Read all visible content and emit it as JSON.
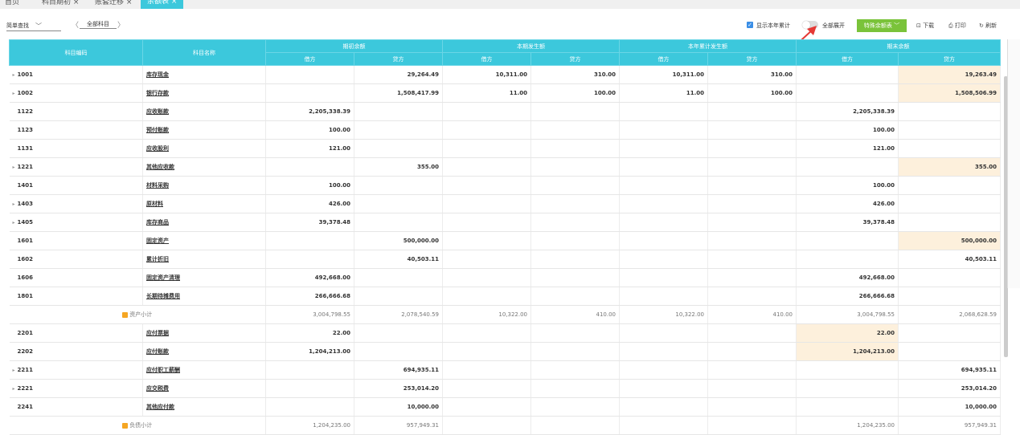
{
  "tabs": [
    "首页",
    "科目期初 ×",
    "账套迁移 ×",
    "余额表 ×"
  ],
  "toolbar": {
    "quick_find": "简单查找",
    "prev": "〈",
    "next": "〉",
    "all_subjects": "全部科目",
    "show_year_label": "显示本年累计",
    "expand_all_label": "全部展开",
    "special_label": "特殊余额表",
    "download": "下载",
    "print": "打印",
    "refresh": "刷新"
  },
  "headers": {
    "code": "科目编码",
    "name": "科目名称",
    "groups": [
      "期初余额",
      "本期发生额",
      "本年累计发生额",
      "期末余额"
    ],
    "debit": "借方",
    "credit": "贷方"
  },
  "rows": [
    {
      "code": "1001",
      "name": "库存现金",
      "expand": true,
      "v": [
        "",
        "29,264.49",
        "10,311.00",
        "310.00",
        "10,311.00",
        "310.00",
        "",
        "19,263.49"
      ],
      "hl": [
        7
      ]
    },
    {
      "code": "1002",
      "name": "银行存款",
      "expand": true,
      "v": [
        "",
        "1,508,417.99",
        "11.00",
        "100.00",
        "11.00",
        "100.00",
        "",
        "1,508,506.99"
      ],
      "hl": [
        7
      ]
    },
    {
      "code": "1122",
      "name": "应收账款",
      "v": [
        "2,205,338.39",
        "",
        "",
        "",
        "",
        "",
        "2,205,338.39",
        ""
      ]
    },
    {
      "code": "1123",
      "name": "预付账款",
      "v": [
        "100.00",
        "",
        "",
        "",
        "",
        "",
        "100.00",
        ""
      ]
    },
    {
      "code": "1131",
      "name": "应收股利",
      "v": [
        "121.00",
        "",
        "",
        "",
        "",
        "",
        "121.00",
        ""
      ]
    },
    {
      "code": "1221",
      "name": "其他应收款",
      "expand": true,
      "v": [
        "",
        "355.00",
        "",
        "",
        "",
        "",
        "",
        "355.00"
      ],
      "hl": [
        7
      ]
    },
    {
      "code": "1401",
      "name": "材料采购",
      "v": [
        "100.00",
        "",
        "",
        "",
        "",
        "",
        "100.00",
        ""
      ]
    },
    {
      "code": "1403",
      "name": "原材料",
      "expand": true,
      "v": [
        "426.00",
        "",
        "",
        "",
        "",
        "",
        "426.00",
        ""
      ]
    },
    {
      "code": "1405",
      "name": "库存商品",
      "expand": true,
      "v": [
        "39,378.48",
        "",
        "",
        "",
        "",
        "",
        "39,378.48",
        ""
      ]
    },
    {
      "code": "1601",
      "name": "固定资产",
      "v": [
        "",
        "500,000.00",
        "",
        "",
        "",
        "",
        "",
        "500,000.00"
      ],
      "hl": [
        7
      ]
    },
    {
      "code": "1602",
      "name": "累计折旧",
      "v": [
        "",
        "40,503.11",
        "",
        "",
        "",
        "",
        "",
        "40,503.11"
      ]
    },
    {
      "code": "1606",
      "name": "固定资产清理",
      "v": [
        "492,668.00",
        "",
        "",
        "",
        "",
        "",
        "492,668.00",
        ""
      ]
    },
    {
      "code": "1801",
      "name": "长期待摊费用",
      "v": [
        "266,666.68",
        "",
        "",
        "",
        "",
        "",
        "266,666.68",
        ""
      ]
    },
    {
      "subtotal": true,
      "name": "资产小计",
      "v": [
        "3,004,798.55",
        "2,078,540.59",
        "10,322.00",
        "410.00",
        "10,322.00",
        "410.00",
        "3,004,798.55",
        "2,068,628.59"
      ]
    },
    {
      "code": "2201",
      "name": "应付票据",
      "v": [
        "22.00",
        "",
        "",
        "",
        "",
        "",
        "22.00",
        ""
      ],
      "hl": [
        6
      ]
    },
    {
      "code": "2202",
      "name": "应付账款",
      "v": [
        "1,204,213.00",
        "",
        "",
        "",
        "",
        "",
        "1,204,213.00",
        ""
      ],
      "hl": [
        6
      ]
    },
    {
      "code": "2211",
      "name": "应付职工薪酬",
      "expand": true,
      "v": [
        "",
        "694,935.11",
        "",
        "",
        "",
        "",
        "",
        "694,935.11"
      ]
    },
    {
      "code": "2221",
      "name": "应交税费",
      "expand": true,
      "v": [
        "",
        "253,014.20",
        "",
        "",
        "",
        "",
        "",
        "253,014.20"
      ]
    },
    {
      "code": "2241",
      "name": "其他应付款",
      "v": [
        "",
        "10,000.00",
        "",
        "",
        "",
        "",
        "",
        "10,000.00"
      ]
    },
    {
      "subtotal": true,
      "name": "负债小计",
      "v": [
        "1,204,235.00",
        "957,949.31",
        "",
        "",
        "",
        "",
        "1,204,235.00",
        "957,949.31"
      ]
    }
  ]
}
